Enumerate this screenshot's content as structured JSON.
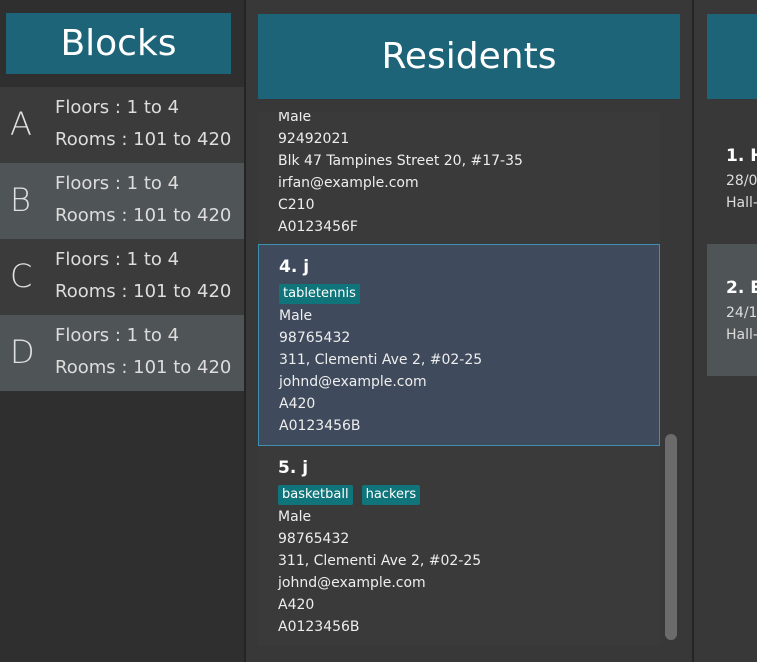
{
  "blocks": {
    "title": "Blocks",
    "items": [
      {
        "letter": "A",
        "floors": "Floors : 1 to 4",
        "rooms": "Rooms : 101 to 420"
      },
      {
        "letter": "B",
        "floors": "Floors : 1 to 4",
        "rooms": "Rooms : 101 to 420"
      },
      {
        "letter": "C",
        "floors": "Floors : 1 to 4",
        "rooms": "Rooms : 101 to 420"
      },
      {
        "letter": "D",
        "floors": "Floors : 1 to 4",
        "rooms": "Rooms : 101 to 420"
      }
    ]
  },
  "residents": {
    "title": "Residents",
    "cards": [
      {
        "gender": "Male",
        "phone": "92492021",
        "address": "Blk 47 Tampines Street 20, #17-35",
        "email": "irfan@example.com",
        "room": "C210",
        "matric": "A0123456F"
      },
      {
        "name": "4.  j",
        "tags": [
          "tabletennis"
        ],
        "gender": "Male",
        "phone": "98765432",
        "address": "311, Clementi Ave 2, #02-25",
        "email": "johnd@example.com",
        "room": "A420",
        "matric": "A0123456B"
      },
      {
        "name": "5.  j",
        "tags": [
          "basketball",
          "hackers"
        ],
        "gender": "Male",
        "phone": "98765432",
        "address": "311, Clementi Ave 2, #02-25",
        "email": "johnd@example.com",
        "room": "A420",
        "matric": "A0123456B"
      }
    ]
  },
  "events": {
    "cards": [
      {
        "title": "1.  H",
        "line1": "28/0",
        "line2": "Hall-"
      },
      {
        "title": "2.  E",
        "line1": "24/1",
        "line2": "Hall-"
      }
    ]
  },
  "colors": {
    "header": "#1d6478",
    "tag": "#10757a",
    "selected_card": "#3f4a5c",
    "selected_border": "#3e8fb0"
  }
}
